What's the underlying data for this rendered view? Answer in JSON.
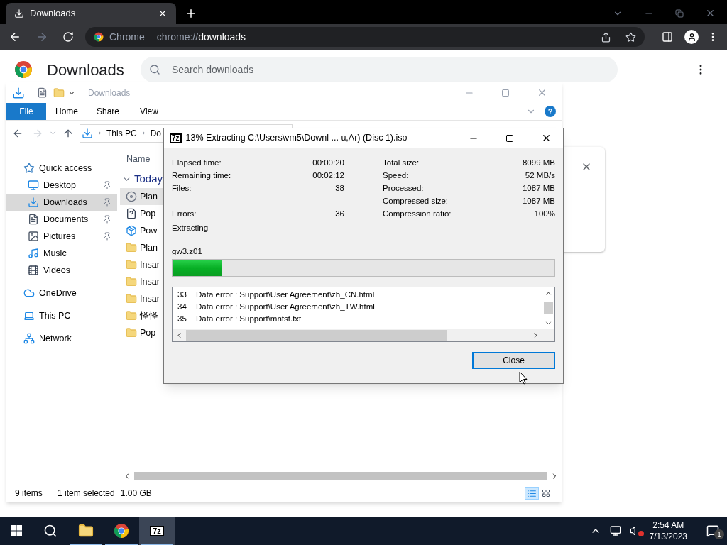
{
  "browser": {
    "tab_title": "Downloads",
    "omnibox_site": "Chrome",
    "url_scheme": "chrome://",
    "url_path": "downloads"
  },
  "page": {
    "title": "Downloads",
    "search_placeholder": "Search downloads"
  },
  "explorer": {
    "title": "Downloads",
    "ribbon_tabs": [
      {
        "label": "File",
        "kind": "file"
      },
      {
        "label": "Home",
        "kind": "tab"
      },
      {
        "label": "Share",
        "kind": "tab"
      },
      {
        "label": "View",
        "kind": "tab"
      }
    ],
    "breadcrumb": [
      "This PC",
      "Do"
    ],
    "nav": [
      {
        "label": "Quick access",
        "kind": "star",
        "selected": false,
        "children": [
          {
            "label": "Desktop",
            "kind": "desktop",
            "selected": false,
            "pinned": true
          },
          {
            "label": "Downloads",
            "kind": "download",
            "selected": true,
            "pinned": true
          },
          {
            "label": "Documents",
            "kind": "document",
            "selected": false,
            "pinned": true
          },
          {
            "label": "Pictures",
            "kind": "picture",
            "selected": false,
            "pinned": true
          },
          {
            "label": "Music",
            "kind": "music",
            "selected": false,
            "pinned": false
          },
          {
            "label": "Videos",
            "kind": "video",
            "selected": false,
            "pinned": false
          }
        ]
      },
      {
        "label": "OneDrive",
        "kind": "cloud",
        "selected": false
      },
      {
        "label": "This PC",
        "kind": "pc",
        "selected": false
      },
      {
        "label": "Network",
        "kind": "network",
        "selected": false
      }
    ],
    "help": "?",
    "column": "Name",
    "group": "Today",
    "files": [
      {
        "name": "Plan",
        "kind": "disc",
        "selected": true
      },
      {
        "name": "Pop",
        "kind": "setup",
        "selected": false
      },
      {
        "name": "Pow",
        "kind": "installer",
        "selected": false
      },
      {
        "name": "Plan",
        "kind": "folder",
        "selected": false
      },
      {
        "name": "Insar",
        "kind": "folder",
        "selected": false
      },
      {
        "name": "Insar",
        "kind": "folder",
        "selected": false
      },
      {
        "name": "Insar",
        "kind": "folder",
        "selected": false
      },
      {
        "name": "怪怪",
        "kind": "folder",
        "selected": false
      },
      {
        "name": "Pop",
        "kind": "folder",
        "selected": false
      }
    ],
    "status": {
      "count": "9 items",
      "selection": "1 item selected",
      "size": "1.00 GB"
    },
    "views": [
      {
        "kind": "details",
        "selected": true
      },
      {
        "kind": "tiles",
        "selected": false
      }
    ]
  },
  "dialog": {
    "app_icon": "7z",
    "title": "13% Extracting C:\\Users\\vm5\\Downl ... u,Ar) (Disc 1).iso",
    "left_stats": [
      {
        "label": "Elapsed time:",
        "value": "00:00:20",
        "kind": "stat"
      },
      {
        "label": "Remaining time:",
        "value": "00:02:12",
        "kind": "stat"
      },
      {
        "label": "Files:",
        "value": "38",
        "kind": "stat"
      },
      {
        "label": "Errors:",
        "value": "36",
        "kind": "error"
      }
    ],
    "right_stats": [
      {
        "label": "Total size:",
        "value": "8099 MB"
      },
      {
        "label": "Speed:",
        "value": "52 MB/s"
      },
      {
        "label": "Processed:",
        "value": "1087 MB"
      },
      {
        "label": "Compressed size:",
        "value": "1087 MB"
      },
      {
        "label": "Compression ratio:",
        "value": "100%"
      }
    ],
    "action": "Extracting",
    "current_file": "gw3.z01",
    "level": 0.13,
    "log": [
      {
        "number": "33",
        "text": "Data error : Support\\User Agreement\\zh_CN.html"
      },
      {
        "number": "34",
        "text": "Data error : Support\\User Agreement\\zh_TW.html"
      },
      {
        "number": "35",
        "text": "Data error : Support\\mnfst.txt"
      }
    ],
    "close_button": "Close"
  },
  "taskbar": {
    "apps": [
      {
        "kind": "explorer",
        "active": true,
        "selected": false
      },
      {
        "kind": "chrome",
        "active": true,
        "selected": false
      },
      {
        "kind": "sevenzip",
        "label": "7z",
        "active": true,
        "selected": true
      }
    ],
    "time": "2:54 AM",
    "date": "7/13/2023",
    "notifications": "1"
  }
}
